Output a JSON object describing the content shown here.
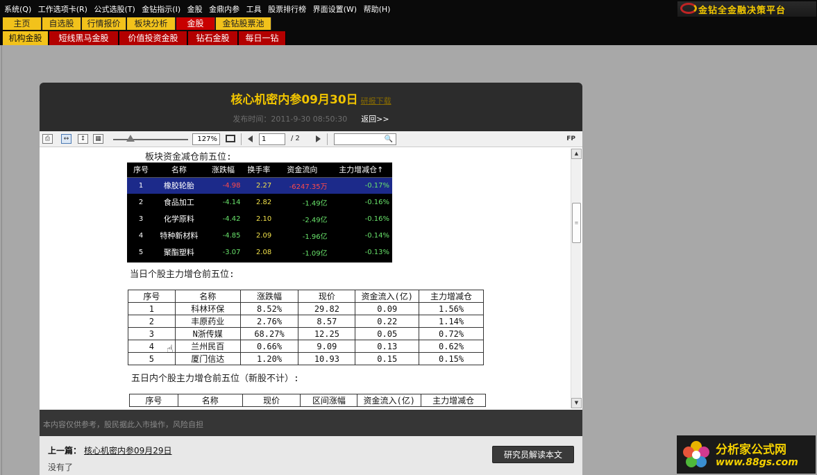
{
  "menubar": {
    "items": [
      "系统(Q)",
      "工作选项卡(R)",
      "公式选股(T)",
      "金钻指示(I)",
      "金股",
      "金鼎内参",
      "工具",
      "股票排行榜",
      "界面设置(W)",
      "帮助(H)"
    ],
    "brand": "金钻全金融决策平台"
  },
  "tabs_primary": [
    "主页",
    "自选股",
    "行情报价",
    "板块分析",
    "金股",
    "金钻股票池"
  ],
  "tabs_secondary": [
    "机构金股",
    "短线黑马金股",
    "价值投资金股",
    "钻石金股",
    "每日一钻"
  ],
  "article": {
    "title": "核心机密内参09月30日",
    "download": "研报下载",
    "publish_time": "发布时间：2011-9-30 08:50:30",
    "back": "返回>>"
  },
  "toolbar": {
    "zoom": "127%",
    "page": "1",
    "total": "/ 2",
    "fp": "FP"
  },
  "doc": {
    "heading1": "板块资金减仓前五位:",
    "heading2": "当日个股主力增仓前五位:",
    "heading3": "五日内个股主力增仓前五位（新股不计）:",
    "sector_table": {
      "headers": [
        "序号",
        "名称",
        "涨跌幅",
        "换手率",
        "资金流向",
        "主力增减仓↑"
      ],
      "rows": [
        [
          "1",
          "橡胶轮胎",
          "-4.98",
          "2.27",
          "-6247.35万",
          "-0.17%"
        ],
        [
          "2",
          "食品加工",
          "-4.14",
          "2.82",
          "-1.49亿",
          "-0.16%"
        ],
        [
          "3",
          "化学原料",
          "-4.42",
          "2.10",
          "-2.49亿",
          "-0.16%"
        ],
        [
          "4",
          "特种新材料",
          "-4.85",
          "2.09",
          "-1.96亿",
          "-0.14%"
        ],
        [
          "5",
          "聚酯塑料",
          "-3.07",
          "2.08",
          "-1.09亿",
          "-0.13%"
        ]
      ]
    },
    "stock_table": {
      "headers": [
        "序号",
        "名称",
        "涨跌幅",
        "现价",
        "资金流入(亿)",
        "主力增减仓"
      ],
      "rows": [
        [
          "1",
          "科林环保",
          "8.52%",
          "29.82",
          "0.09",
          "1.56%"
        ],
        [
          "2",
          "丰原药业",
          "2.76%",
          "8.57",
          "0.22",
          "1.14%"
        ],
        [
          "3",
          "N浙传媒",
          "68.27%",
          "12.25",
          "0.05",
          "0.72%"
        ],
        [
          "4",
          "兰州民百",
          "0.66%",
          "9.09",
          "0.13",
          "0.62%"
        ],
        [
          "5",
          "厦门信达",
          "1.20%",
          "10.93",
          "0.15",
          "0.15%"
        ]
      ]
    },
    "five_day_table": {
      "headers": [
        "序号",
        "名称",
        "现价",
        "区间涨幅",
        "资金流入(亿)",
        "主力增减仓"
      ]
    }
  },
  "footer": {
    "disclaimer": "本内容仅供参考，股民据此入市操作，风险自担",
    "prev_label": "上一篇：",
    "prev_link": "核心机密内参09月29日",
    "next_text": "没有了",
    "analyst_button": "研究员解读本文"
  },
  "watermark": {
    "title": "分析家公式网",
    "url": "www.88gs.com"
  },
  "colors": {
    "accent_gold": "#f0c400",
    "tab_red": "#b30000",
    "tab_yellow": "#f2c21b",
    "sector_red": "#ff4a4a",
    "sector_green": "#69e46b"
  },
  "icons": [
    "print-icon",
    "fit-width-icon",
    "fit-height-icon",
    "thumbnails-icon",
    "monitor-icon",
    "prev-page-icon",
    "next-page-icon",
    "search-icon",
    "hand-cursor-icon"
  ]
}
